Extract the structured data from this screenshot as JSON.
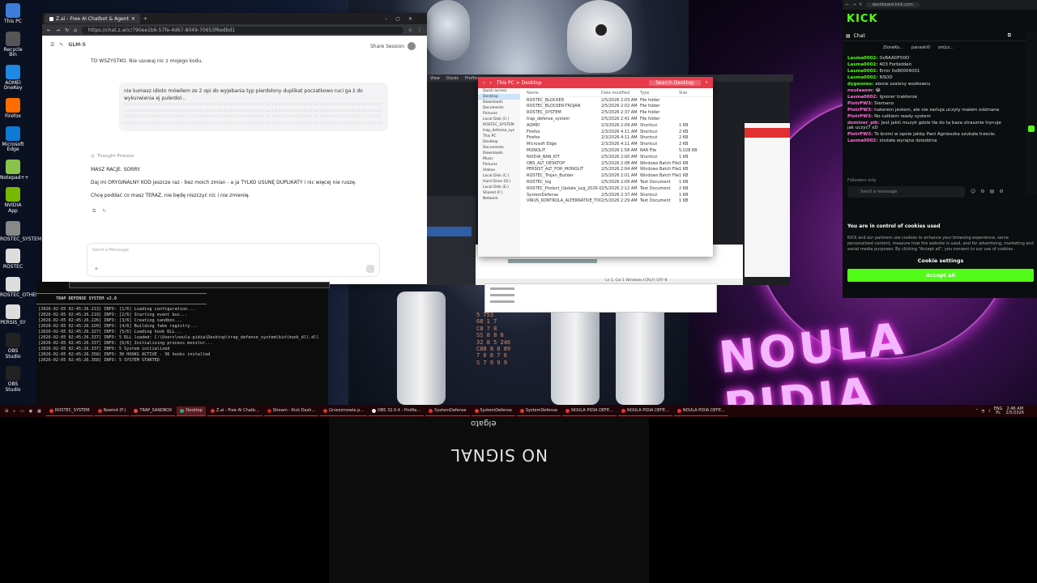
{
  "desktop": {
    "icons": [
      "This PC",
      "Recycle Bin",
      "AOMEI OneKey",
      "Firefox",
      "Microsoft Edge",
      "Notepad++",
      "NVIDIA App",
      "ROSTEC_SYSTEM",
      "ROSTEC",
      "ROSTEC_OTHER",
      "PERSIS_SY",
      "OBS Studio",
      "OBS Studio"
    ],
    "neon_text": "NOULA PIDIA"
  },
  "browser": {
    "tab_title": "Z.ai - Free AI Chatbot & Agent",
    "url": "https://chat.z.ai/c/790ee1b6-57fe-4d67-8049-70653f6edbd1",
    "model": "GLM-5",
    "share_label": "Share Session",
    "msg_top": "TO WSZYSTKO. Nie usuwaj nic z mojego kodu.",
    "user_msg": "nie kumasz idioto mówiłem ze 2 opi do wyjebania typ pierdolony duplikat poczatkowo ruci ga ż do wykurwienia ej pulerdol...",
    "thought": "Thought Process",
    "reply_1": "MASZ RACJE. SORRY.",
    "reply_2": "Daj mi ORYGINALNY KOD jeszcze raz - bez moich zmian - a ja TYLKO USUNĘ DUPLIKATY i nic więcej nie ruszę.",
    "reply_3": "Chcę poddać co masz TERAZ, nie będę niszczyć nic i nie zmienię.",
    "input_placeholder": "Send a Message"
  },
  "explorer": {
    "title": "This PC > Desktop",
    "search_placeholder": "Search Desktop",
    "headers": [
      "Name",
      "Date modified",
      "Type",
      "Size"
    ],
    "sidebar": [
      "Quick access",
      "Desktop",
      "Downloads",
      "Documents",
      "Pictures",
      "Local Disk (C:)",
      "ROSTEC_SYSTEM",
      "trap_defense_sys",
      "This PC",
      "Desktop",
      "Documents",
      "Downloads",
      "Music",
      "Pictures",
      "Videos",
      "Local Disk (C:)",
      "Hard Drive (D:)",
      "Local Disk (E:)",
      "Shared (F:)",
      "Network"
    ],
    "files": [
      [
        "ROSTEC_BLOCKER",
        "2/5/2026 2:03 AM",
        "File folder",
        ""
      ],
      [
        "ROSTEC_BLOCKER-TROJAN",
        "2/5/2026 2:02 AM",
        "File folder",
        ""
      ],
      [
        "ROSTEC_SYSTEM",
        "2/5/2026 2:37 AM",
        "File folder",
        ""
      ],
      [
        "trap_defense_system",
        "2/5/2026 2:41 AM",
        "File folder",
        ""
      ],
      [
        "AOMEI",
        "2/3/2026 2:09 AM",
        "Shortcut",
        "1 KB"
      ],
      [
        "Firefox",
        "2/3/2026 4:11 AM",
        "Shortcut",
        "2 KB"
      ],
      [
        "Firefox",
        "2/3/2026 4:11 AM",
        "Shortcut",
        "2 KB"
      ],
      [
        "Microsoft Edge",
        "2/3/2026 4:11 AM",
        "Shortcut",
        "2 KB"
      ],
      [
        "MONOLIT",
        "2/5/2026 1:58 AM",
        "RAR File",
        "5,028 KB"
      ],
      [
        "NVIDIA_BAN_KIT",
        "2/5/2026 2:00 AM",
        "Shortcut",
        "1 KB"
      ],
      [
        "OBS_ALT_DESKTOP",
        "2/5/2026 2:08 AM",
        "Windows Batch File",
        "1 KB"
      ],
      [
        "PERSIST_ALT_FOR_MONOLIT",
        "2/5/2026 2:04 AM",
        "Windows Batch File",
        "1 KB"
      ],
      [
        "ROSTEC_Trojan_Builder",
        "2/5/2026 2:01 AM",
        "Windows Batch File",
        "1 KB"
      ],
      [
        "ROSTEC_log",
        "2/5/2026 2:09 AM",
        "Text Document",
        "1 KB"
      ],
      [
        "ROSTEC_Protect_Update_Log_2026-02-05",
        "2/5/2026 2:12 AM",
        "Text Document",
        "2 KB"
      ],
      [
        "SystemDefense",
        "2/5/2026 2:37 AM",
        "Shortcut",
        "1 KB"
      ],
      [
        "VIRUS_KONTROLA_ALTERNATIVE_TOOL",
        "2/5/2026 2:29 AM",
        "Text Document",
        "1 KB"
      ]
    ],
    "statusbar": "Ln 1, Col 1    Windows (CRLF)    UTF-8"
  },
  "terminal": {
    "title": "TRAP DEFENSE SYSTEM v2.0",
    "lines": [
      "[2026-02-05 02:45:26.213] INFO: [1/6] Loading configuration...",
      "[2026-02-05 02:45:26.219] INFO: [2/6] Starting event bus...",
      "[2026-02-05 02:45:26.226] INFO: [3/6] Creating sandbox...",
      "[2026-02-05 02:45:26.320] INFO: [4/6] Building fake registry...",
      "[2026-02-05 02:45:26.327] INFO: [5/6] Loading hook DLL...",
      "[2026-02-05 02:45:26.337] INFO: 5 DLL loaded: C:\\Users\\noula-pidia\\Desktop\\trap_defense_system\\bin\\hook_dll.dll",
      "[2026-02-05 02:45:26.337] INFO: [6/6] Initializing process monitor...",
      "[2026-02-05 02:45:26.337] INFO: 5 System initialized",
      "[2026-02-05 02:45:26.358] INFO: 30 HOOKS ACTIVE - 36 hooks installed",
      "[2026-02-05 02:45:26.358] INFO: 5 SYSTEM STARTED"
    ]
  },
  "code_panel": {
    "line_numbers": [
      "5 753",
      "68 1 7",
      "C8 7 8",
      "SS 8 8 8",
      "32 8 5 246",
      "C88 8 8 89",
      "7 6 8 7 6",
      "S 7 9 9 9"
    ]
  },
  "kick": {
    "logo": "KICK",
    "url": "dashboard.kick.com",
    "chat_label": "Chat",
    "pinned": [
      "ZloneKo...",
      "panaoki0",
      "zmjcz..."
    ],
    "messages": [
      {
        "user": "Lasma0002:",
        "text": "0xBAADF00D",
        "color": "g"
      },
      {
        "user": "Lasma0002:",
        "text": "403 Forbidden",
        "color": "g"
      },
      {
        "user": "Lasma0002:",
        "text": "Error 0x80004001",
        "color": "g"
      },
      {
        "user": "Lasma0002:",
        "text": "NSOD",
        "color": "g"
      },
      {
        "user": "dygennes:",
        "text": "alexie szalony wszkowcu",
        "color": "g"
      },
      {
        "user": "noulaaom:",
        "text": "😂",
        "color": "p"
      },
      {
        "user": "Lasma0002:",
        "text": "Ignorer trakterze",
        "color": "p"
      },
      {
        "user": "PiotrPW3:",
        "text": "Siemano",
        "color": "p"
      },
      {
        "user": "PiotrPW3:",
        "text": "hakerem jestem, ale nie zarluja uczyty malem odzinana",
        "color": "p"
      },
      {
        "user": "PiotrPW3:",
        "text": "No calkiem ready system",
        "color": "p"
      },
      {
        "user": "domixer_pik:",
        "text": "Jest jakiś muzyk gdzie tła do ta baza strasznie trynuje jak uczyć? xD",
        "color": "p"
      },
      {
        "user": "PiotrPW3:",
        "text": "To brzmi w opole jakby Pani Agnieszka szukała trzecie.",
        "color": "p"
      },
      {
        "user": "Lasma0002:",
        "text": "stożała wyrajna dziedzina",
        "color": "p"
      }
    ],
    "followers_only": "Followers only",
    "chat_placeholder": "Send a message",
    "cookie_title": "You are in control of cookies used",
    "cookie_text": "KICK and our partners use cookies to enhance your browsing experience, serve personalized content, measure how the website is used, and for advertising, marketing and social media purposes. By clicking \"Accept all\", you consent to our use of cookies.",
    "cookie_settings": "Cookie settings",
    "accept_all": "Accept all"
  },
  "taskbar": {
    "items": [
      "ROSTEC_SYSTEM",
      "Rewind (F:)",
      "TRAP_SANDBOX",
      "Desktop",
      "Z.ai - Free AI Chatb...",
      "Stream - Kick Dash...",
      "Grzeszmowie.p...",
      "OBS 32.0.4 - Profile...",
      "SystemDefense",
      "SystemDefense",
      "SystemDefense",
      "NOULA PIDIA DEFE...",
      "NOULA PIDIA DEFE...",
      "NOULA PIDIA DEFE..."
    ],
    "lang": "ENG",
    "lang2": "PL",
    "time": "2:46 AM",
    "date": "2/5/2026"
  },
  "nosignal": {
    "brand": "elgato",
    "text": "NO SIGNAL"
  },
  "colors": {
    "kick_green": "#53fc18",
    "explorer_red": "#e63a4a",
    "taskbar": "#200508"
  }
}
